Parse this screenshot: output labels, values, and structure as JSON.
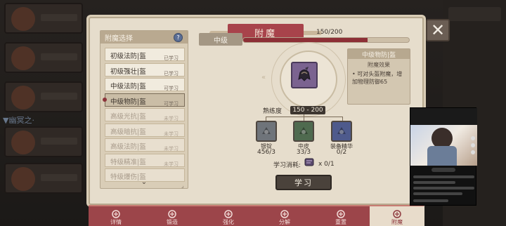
{
  "dialog": {
    "title": "附魔",
    "close_symbol": "✕"
  },
  "background": {
    "side_text": "▼幽冥之·"
  },
  "enchant_list": {
    "header": "附魔选择",
    "help_symbol": "?",
    "scroll_symbol": "⌄",
    "corner_symbol": "⌟",
    "items": [
      {
        "name": "初级法防|盔",
        "status": "已学习",
        "state": "learned"
      },
      {
        "name": "初级强壮|盔",
        "status": "已学习",
        "state": "learned"
      },
      {
        "name": "中级法防|盔",
        "status": "可学习",
        "state": "learnable"
      },
      {
        "name": "中级物防|盔",
        "status": "可学习",
        "state": "selected"
      },
      {
        "name": "高级光抗|盔",
        "status": "未学习",
        "state": "locked"
      },
      {
        "name": "高级暗抗|盔",
        "status": "未学习",
        "state": "locked"
      },
      {
        "name": "高级法防|盔",
        "status": "未学习",
        "state": "locked"
      },
      {
        "name": "特级精准|盔",
        "status": "未学习",
        "state": "locked"
      },
      {
        "name": "特级爆伤|盔",
        "status": "",
        "state": "locked"
      }
    ]
  },
  "level": {
    "label": "中级",
    "progress_text": "150/200",
    "progress": 0.75,
    "bar_color": "#8d2f36"
  },
  "emblem": {
    "icon": "helmet-icon",
    "deco_left": "«",
    "deco_right": "»"
  },
  "info": {
    "title": "中级物防|盔",
    "subtitle": "附魔效果",
    "description": "• 可对头盔附魔，增加物理防御65"
  },
  "proficiency": {
    "label": "熟练度",
    "value": "150 - 200"
  },
  "materials": [
    {
      "name": "银锭",
      "count": "456/3",
      "icon": "ingot-icon",
      "color": "#6f747a"
    },
    {
      "name": "中皮",
      "count": "33/3",
      "icon": "leather-icon",
      "color": "#4f6a4f"
    },
    {
      "name": "装备精华",
      "count": "0/2",
      "icon": "essence-icon",
      "color": "#4e5a8c"
    }
  ],
  "cost": {
    "label": "学习消耗:",
    "value": "x 0/1",
    "icon": "scroll-icon"
  },
  "learn_button": "学习",
  "tabs": [
    {
      "label": "详情",
      "icon": "details-icon",
      "active": false
    },
    {
      "label": "锻造",
      "icon": "forge-icon",
      "active": false
    },
    {
      "label": "强化",
      "icon": "enhance-icon",
      "active": false
    },
    {
      "label": "分解",
      "icon": "decompose-icon",
      "active": false
    },
    {
      "label": "重置",
      "icon": "reset-icon",
      "active": false
    },
    {
      "label": "附魔",
      "icon": "enchant-icon",
      "active": true
    }
  ]
}
